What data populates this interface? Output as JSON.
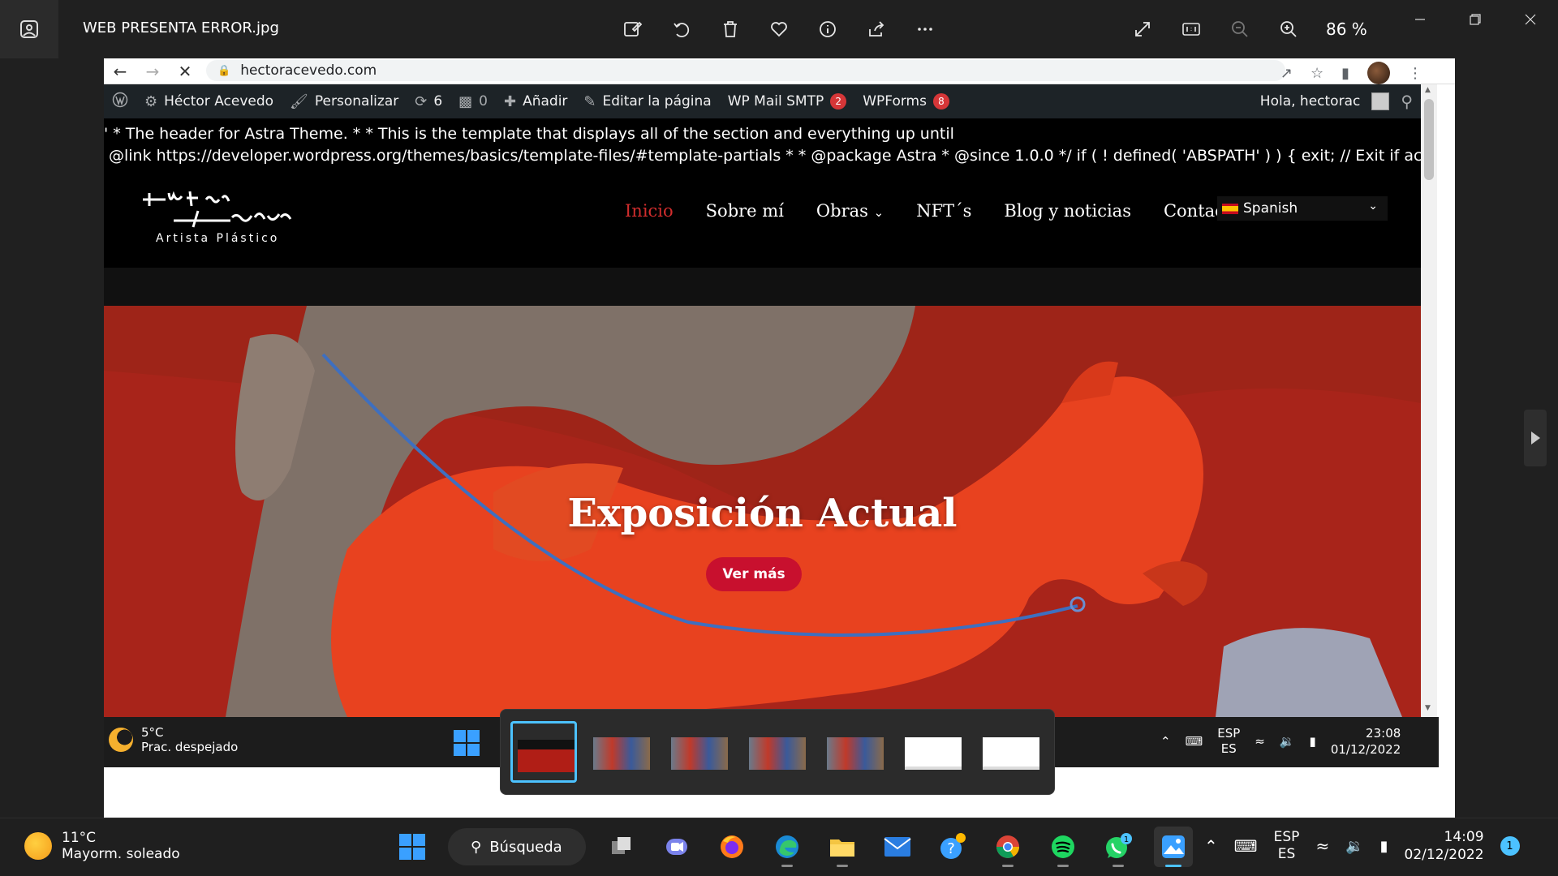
{
  "viewer": {
    "title": "WEB PRESENTA ERROR.jpg",
    "zoom": "86 %"
  },
  "browser": {
    "url": "hectoracevedo.com"
  },
  "adminbar": {
    "site_name": "Héctor Acevedo",
    "customize": "Personalizar",
    "updates": "6",
    "comments": "0",
    "add": "Añadir",
    "edit": "Editar la página",
    "smtp": "WP Mail SMTP",
    "smtp_badge": "2",
    "wpforms": "WPForms",
    "wpforms_badge": "8",
    "greeting": "Hola, hectorac"
  },
  "php_lines": [
    "' * The header for Astra Theme. * * This is the template that displays all of the section and everything up until",
    "@link https://developer.wordpress.org/themes/basics/template-files/#template-partials * * @package Astra * @since 1.0.0 */ if ( ! defined( 'ABSPATH' ) ) { exit; // Exit if accessed directly. } ?>"
  ],
  "site": {
    "logo_subtitle": "Artista Plástico",
    "menu": [
      "Inicio",
      "Sobre mí",
      "Obras",
      "NFT´s",
      "Blog y noticias",
      "Contacto"
    ],
    "language": "Spanish"
  },
  "hero": {
    "title": "Exposición Actual",
    "button": "Ver más"
  },
  "inner_taskbar": {
    "temp": "5°C",
    "condition": "Prac. despejado",
    "lang1": "ESP",
    "lang2": "ES",
    "time": "23:08",
    "date": "01/12/2022"
  },
  "taskbar": {
    "temp": "11°C",
    "condition": "Mayorm. soleado",
    "search": "Búsqueda",
    "lang1": "ESP",
    "lang2": "ES",
    "time": "14:09",
    "date": "02/12/2022",
    "notifications": "1",
    "whatsapp_badge": "1"
  },
  "colors": {
    "accent_red": "#d12d2d",
    "button_red": "#c8102e",
    "admin_bg": "#1d2327",
    "badge": "#d63638",
    "windows_blue": "#4cc2ff"
  }
}
